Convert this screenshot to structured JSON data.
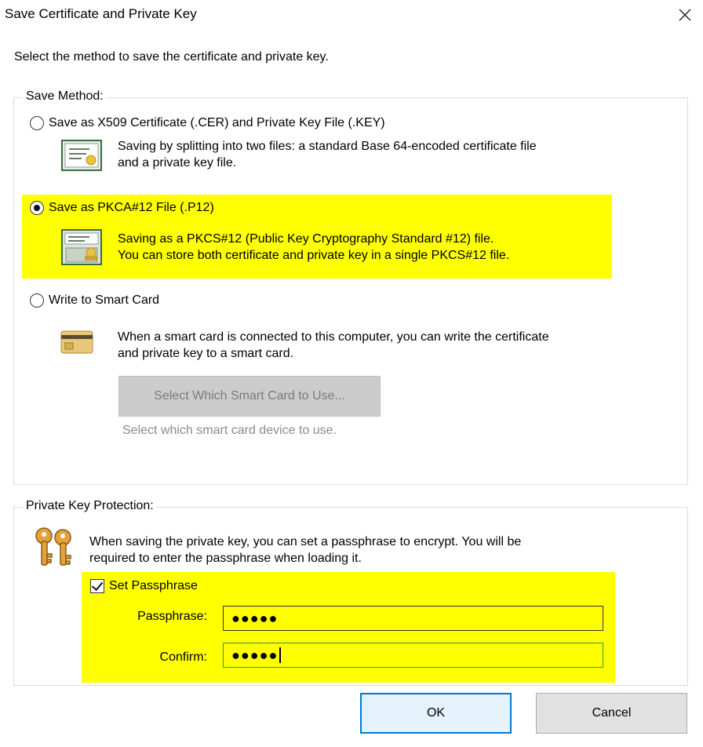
{
  "window": {
    "title": "Save Certificate and Private Key"
  },
  "intro": "Select the method to save the certificate and private key.",
  "save_method": {
    "legend": "Save Method:",
    "options": [
      {
        "label": "Save as X509 Certificate (.CER) and Private Key File (.KEY)",
        "selected": false,
        "desc_line1": "Saving by splitting into two files: a standard Base 64-encoded certificate file",
        "desc_line2": "and a private key file.",
        "icon": "certificate-icon"
      },
      {
        "label": "Save as PKCA#12 File (.P12)",
        "selected": true,
        "desc_line1": "Saving as a PKCS#12 (Public Key Cryptography Standard #12) file.",
        "desc_line2": "You can store both certificate and private key in a single PKCS#12 file.",
        "icon": "pkcs12-file-icon"
      },
      {
        "label": "Write to Smart Card",
        "selected": false,
        "desc_line1": "When a smart card is connected to this computer, you can write the certificate",
        "desc_line2": "and private key to a smart card.",
        "icon": "smart-card-icon"
      }
    ],
    "smart_card_button": "Select Which Smart Card to Use...",
    "smart_card_hint": "Select which smart card device to use."
  },
  "protection": {
    "legend": "Private Key Protection:",
    "desc_line1": "When saving the private key, you can set a passphrase to encrypt. You will be",
    "desc_line2": "required to enter the passphrase when loading it.",
    "set_passphrase_label": "Set Passphrase",
    "set_passphrase_checked": true,
    "passphrase_label": "Passphrase:",
    "passphrase_value": "●●●●●",
    "confirm_label": "Confirm:",
    "confirm_value": "●●●●●"
  },
  "buttons": {
    "ok": "OK",
    "cancel": "Cancel"
  },
  "colors": {
    "highlight": "#ffff00",
    "focus_border": "#0078d7",
    "confirm_border": "#2f9b3a"
  }
}
